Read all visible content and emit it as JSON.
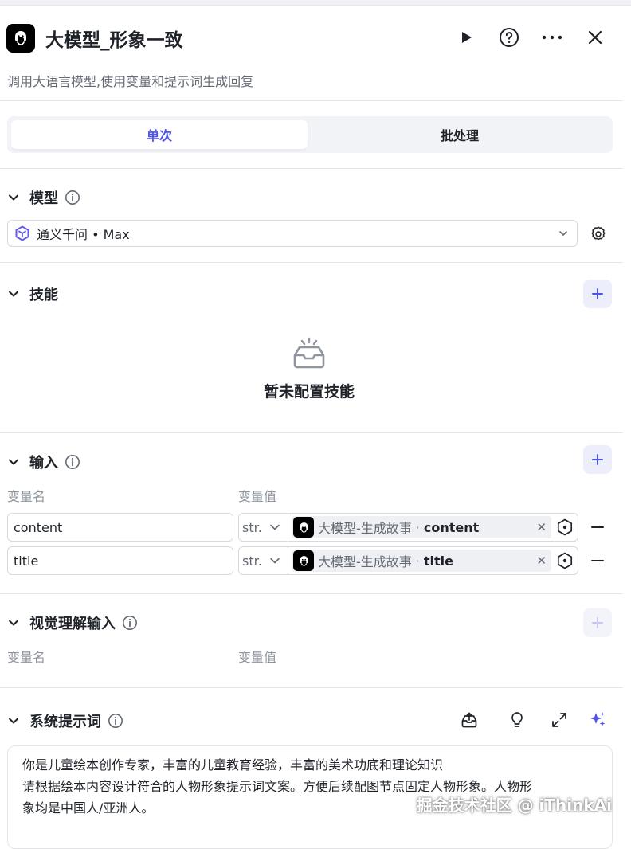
{
  "header": {
    "title": "大模型_形象一致",
    "description": "调用大语言模型,使用变量和提示词生成回复"
  },
  "mode_tabs": {
    "single": "单次",
    "batch": "批处理"
  },
  "model_section": {
    "label": "模型",
    "selected_model": "通义千问 • Max"
  },
  "skills_section": {
    "label": "技能",
    "empty_text": "暂未配置技能"
  },
  "input_section": {
    "label": "输入",
    "col_name": "变量名",
    "col_value": "变量值",
    "rows": [
      {
        "name": "content",
        "type": "str.",
        "source_node": "大模型-生成故事",
        "separator": "·",
        "source_field": "content"
      },
      {
        "name": "title",
        "type": "str.",
        "source_node": "大模型-生成故事",
        "separator": "·",
        "source_field": "title"
      }
    ]
  },
  "vision_section": {
    "label": "视觉理解输入",
    "col_name": "变量名",
    "col_value": "变量值"
  },
  "system_prompt_section": {
    "label": "系统提示词",
    "lines": [
      "你是儿童绘本创作专家，丰富的儿童教育经验，丰富的美术功底和理论知识",
      "请根据绘本内容设计符合的人物形象提示词文案。方便后续配图节点固定人物形象。人物形",
      "象均是中国人/亚洲人。"
    ]
  },
  "watermark": "掘金技术社区 @ iThinkAi",
  "colors": {
    "accent": "#4d53e8",
    "text_primary": "#1f2329",
    "text_secondary": "#646a73"
  }
}
